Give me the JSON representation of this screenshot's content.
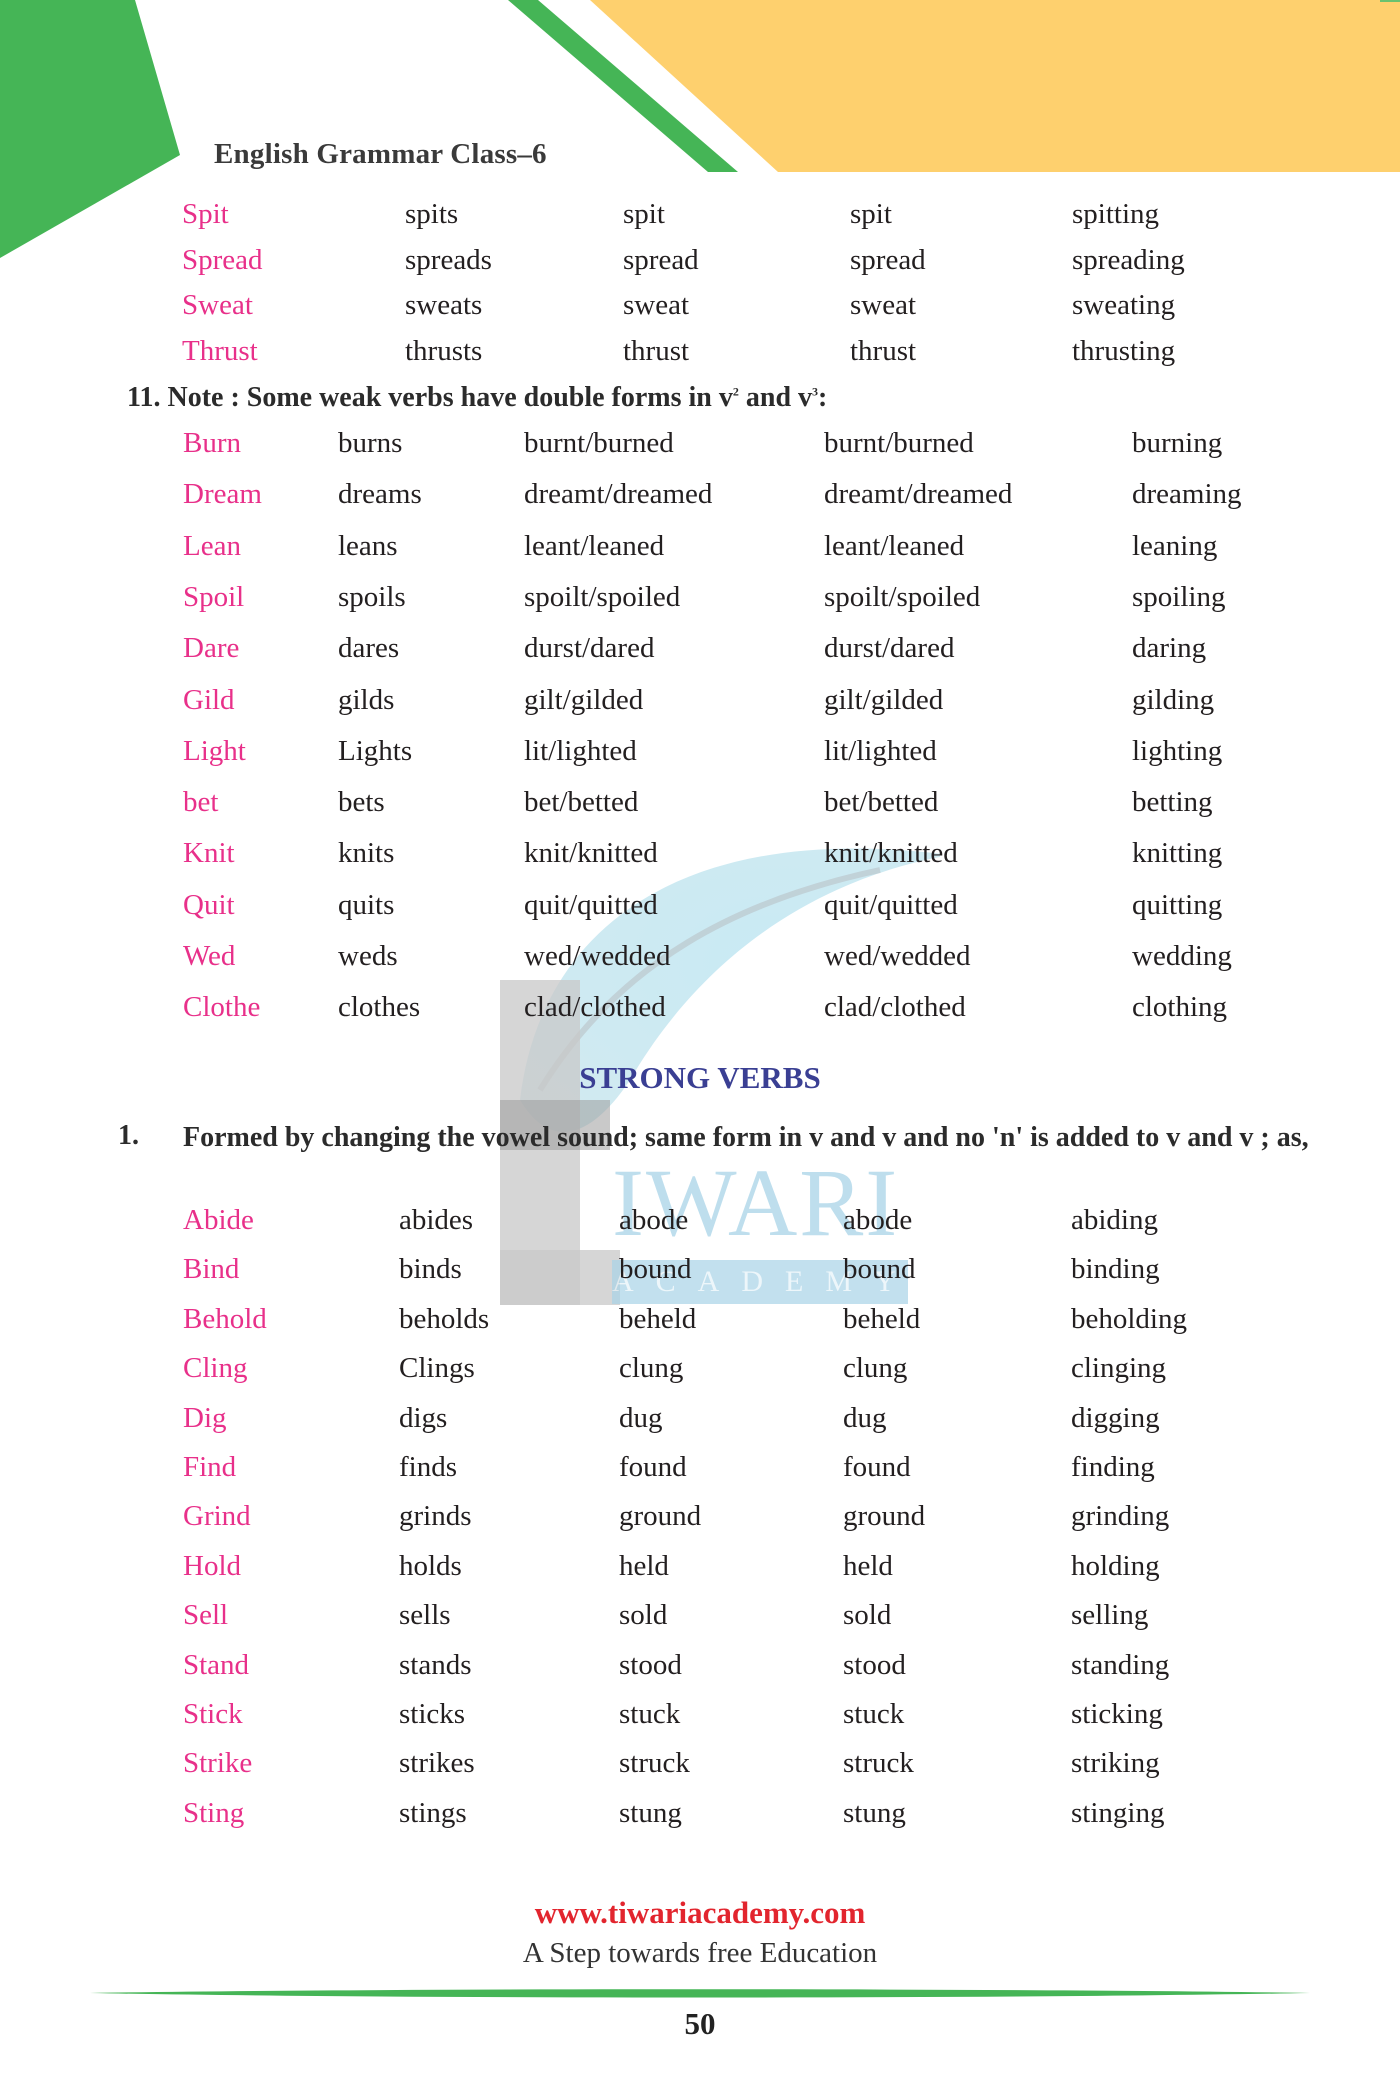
{
  "header": {
    "title": "English Grammar Class–6"
  },
  "colors": {
    "base_verb": "#e8308a",
    "green": "#45b556",
    "yellow": "#fed06e",
    "section_title": "#3a3f93",
    "footer_url": "#e2252e"
  },
  "top_table": [
    [
      "Spit",
      "spits",
      "spit",
      "spit",
      "spitting"
    ],
    [
      "Spread",
      "spreads",
      "spread",
      "spread",
      "spreading"
    ],
    [
      "Sweat",
      "sweats",
      "sweat",
      "sweat",
      "sweating"
    ],
    [
      "Thrust",
      "thrusts",
      "thrust",
      "thrust",
      "thrusting"
    ]
  ],
  "note": {
    "number": "11.",
    "text_before": "Note  : Some weak verbs have double forms in v",
    "sup1": "2",
    "text_mid": " and v",
    "sup2": "3",
    "text_after": ":"
  },
  "weak_table": [
    [
      "Burn",
      "burns",
      "burnt/burned",
      "burnt/burned",
      "burning"
    ],
    [
      "Dream",
      "dreams",
      "dreamt/dreamed",
      "dreamt/dreamed",
      "dreaming"
    ],
    [
      "Lean",
      "leans",
      "leant/leaned",
      "leant/leaned",
      "leaning"
    ],
    [
      "Spoil",
      "spoils",
      "spoilt/spoiled",
      "spoilt/spoiled",
      "spoiling"
    ],
    [
      "Dare",
      "dares",
      "durst/dared",
      "durst/dared",
      "daring"
    ],
    [
      "Gild",
      "gilds",
      "gilt/gilded",
      "gilt/gilded",
      "gilding"
    ],
    [
      "Light",
      "Lights",
      "lit/lighted",
      "lit/lighted",
      "lighting"
    ],
    [
      "bet",
      "bets",
      "bet/betted",
      "bet/betted",
      "betting"
    ],
    [
      "Knit",
      "knits",
      "knit/knitted",
      "knit/knitted",
      "knitting"
    ],
    [
      "Quit",
      "quits",
      "quit/quitted",
      "quit/quitted",
      "quitting"
    ],
    [
      "Wed",
      "weds",
      "wed/wedded",
      "wed/wedded",
      "wedding"
    ],
    [
      "Clothe",
      "clothes",
      "clad/clothed",
      "clad/clothed",
      "clothing"
    ]
  ],
  "strong_section": {
    "title": "STRONG VERBS",
    "rule_number": "1.",
    "rule_text": "Formed by changing the vowel sound; same form in v and v and no 'n' is added to v and v ; as,"
  },
  "strong_table": [
    [
      "Abide",
      "abides",
      "abode",
      "abode",
      "abiding"
    ],
    [
      "Bind",
      "binds",
      "bound",
      "bound",
      "binding"
    ],
    [
      "Behold",
      "beholds",
      "beheld",
      "beheld",
      "beholding"
    ],
    [
      "Cling",
      "Clings",
      "clung",
      "clung",
      "clinging"
    ],
    [
      "Dig",
      "digs",
      "dug",
      "dug",
      "digging"
    ],
    [
      "Find",
      "finds",
      "found",
      "found",
      "finding"
    ],
    [
      "Grind",
      "grinds",
      "ground",
      "ground",
      "grinding"
    ],
    [
      "Hold",
      "holds",
      "held",
      "held",
      "holding"
    ],
    [
      "Sell",
      "sells",
      "sold",
      "sold",
      "selling"
    ],
    [
      "Stand",
      "stands",
      "stood",
      "stood",
      "standing"
    ],
    [
      "Stick",
      "sticks",
      "stuck",
      "stuck",
      "sticking"
    ],
    [
      "Strike",
      "strikes",
      "struck",
      "struck",
      "striking"
    ],
    [
      "Sting",
      "stings",
      "stung",
      "stung",
      "stinging"
    ]
  ],
  "watermark": {
    "word": "IWARI",
    "sub": "ACADEMY"
  },
  "footer": {
    "url": "www.tiwariacademy.com",
    "tagline": "A Step towards free Education",
    "page_number": "50"
  }
}
